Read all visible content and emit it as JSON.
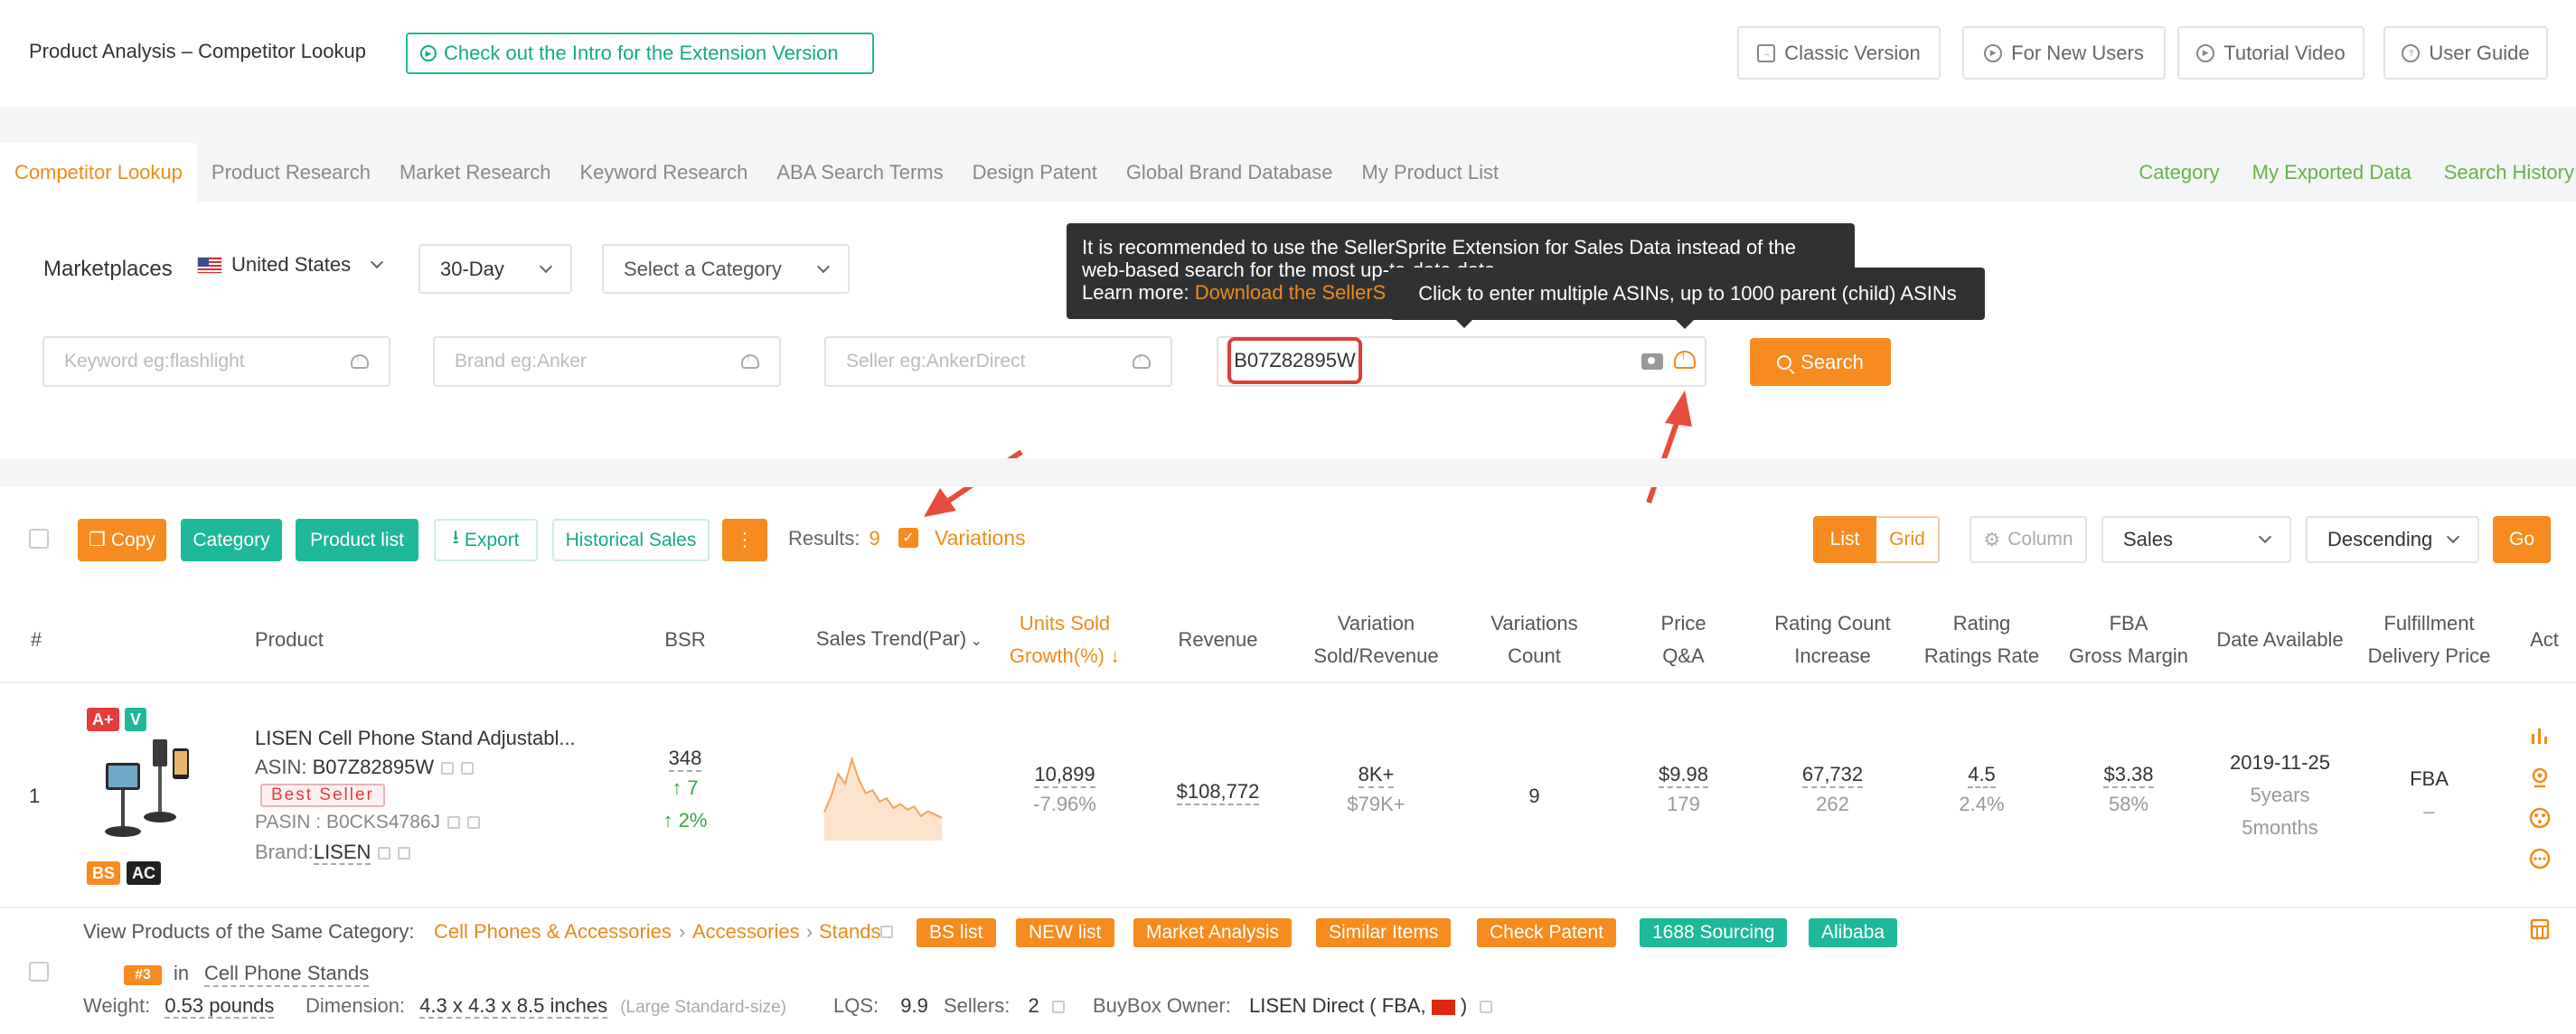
{
  "header": {
    "title": "Product Analysis – Competitor Lookup",
    "intro_btn": "Check out the Intro for the Extension Version",
    "buttons": [
      "Classic Version",
      "For New Users",
      "Tutorial Video",
      "User Guide"
    ]
  },
  "nav": {
    "tabs": [
      "Competitor Lookup",
      "Product Research",
      "Market Research",
      "Keyword Research",
      "ABA Search Terms",
      "Design Patent",
      "Global Brand Database",
      "My Product List"
    ],
    "right_links": [
      "Category",
      "My Exported Data",
      "Search History"
    ]
  },
  "search": {
    "marketplaces_label": "Marketplaces",
    "marketplace": "United States",
    "period": "30-Day",
    "category_placeholder": "Select a Category",
    "keyword_placeholder": "Keyword eg:flashlight",
    "brand_placeholder": "Brand eg:Anker",
    "seller_placeholder": "Seller eg:AnkerDirect",
    "asin_value": "B07Z82895W",
    "search_btn": "Search"
  },
  "tooltips": {
    "extension_line1": "It is recommended to use the SellerSprite Extension for Sales Data instead of the",
    "extension_line2": "web-based search for the most up-to-date data.",
    "extension_learn": "Learn more:",
    "extension_link": "Download the SellerS",
    "multi_asin": "Click to enter multiple ASINs, up to 1000 parent (child) ASINs"
  },
  "toolbar": {
    "copy": "Copy",
    "category": "Category",
    "product_list": "Product list",
    "export": "Export",
    "historical_sales": "Historical Sales",
    "more": "⋮",
    "results_label": "Results:",
    "results_count": "9",
    "variations_label": "Variations",
    "list": "List",
    "grid": "Grid",
    "column": "Column",
    "sort_by": "Sales",
    "order": "Descending",
    "go": "Go"
  },
  "table": {
    "headers": {
      "num": "#",
      "product": "Product",
      "bsr": "BSR",
      "sales_trend": "Sales Trend(Par)",
      "units_sold_1": "Units Sold",
      "units_sold_2": "Growth(%)",
      "revenue": "Revenue",
      "var_sold_1": "Variation",
      "var_sold_2": "Sold/Revenue",
      "var_count_1": "Variations",
      "var_count_2": "Count",
      "price_1": "Price",
      "price_2": "Q&A",
      "rating_count_1": "Rating Count",
      "rating_count_2": "Increase",
      "rating_1": "Rating",
      "rating_2": "Ratings Rate",
      "fba_1": "FBA",
      "fba_2": "Gross Margin",
      "date": "Date Available",
      "fulfill_1": "Fulfillment",
      "fulfill_2": "Delivery Price",
      "act": "Act"
    },
    "row": {
      "index": "1",
      "badges": {
        "aplus": "A+",
        "v": "V",
        "bs": "BS",
        "ac": "AC"
      },
      "title": "LISEN Cell Phone Stand Adjustabl...",
      "asin_label": "ASIN:",
      "asin": "B07Z82895W",
      "best_seller": "Best Seller",
      "pasin": "PASIN : B0CKS4786J",
      "brand_label": "Brand:",
      "brand": "LISEN",
      "bsr": "348",
      "bsr_change": "↑ 7",
      "bsr_pct": "↑ 2%",
      "trend": [
        0.35,
        0.55,
        0.82,
        0.7,
        1.0,
        0.75,
        0.58,
        0.62,
        0.48,
        0.52,
        0.4,
        0.45,
        0.38,
        0.42,
        0.3,
        0.36,
        0.32,
        0.28
      ],
      "units": "10,899",
      "units_growth": "-7.96%",
      "revenue": "$108,772",
      "var_sold": "8K+",
      "var_revenue": "$79K+",
      "var_count": "9",
      "price": "$9.98",
      "qa": "179",
      "rating_count": "67,732",
      "rating_increase": "262",
      "rating": "4.5",
      "ratings_rate": "2.4%",
      "fba": "$3.38",
      "margin": "58%",
      "date": "2019-11-25",
      "age_years": "5years",
      "age_months": "5months",
      "fulfillment": "FBA",
      "delivery": "–"
    }
  },
  "details": {
    "view_label": "View Products of the Same Category:",
    "crumbs": [
      "Cell Phones & Accessories",
      "Accessories",
      "Stands"
    ],
    "tags": [
      "BS list",
      "NEW list",
      "Market Analysis",
      "Similar Items",
      "Check Patent",
      "1688 Sourcing",
      "Alibaba"
    ],
    "rank": "#3",
    "in": "in",
    "rank_category": "Cell Phone Stands",
    "weight_label": "Weight:",
    "weight": "0.53 pounds",
    "dimension_label": "Dimension:",
    "dimension": "4.3 x 4.3 x 8.5 inches",
    "size_tier": "(Large Standard-size)",
    "lqs_label": "LQS:",
    "lqs": "9.9",
    "sellers_label": "Sellers:",
    "sellers": "2",
    "buybox_label": "BuyBox Owner:",
    "buybox": "LISEN Direct",
    "buybox_type": "( FBA,",
    "buybox_close": ")"
  },
  "colors": {
    "accent": "#f68b1f",
    "teal": "#1fb89a",
    "green_link": "#67b346",
    "highlight": "#e23c3c"
  }
}
